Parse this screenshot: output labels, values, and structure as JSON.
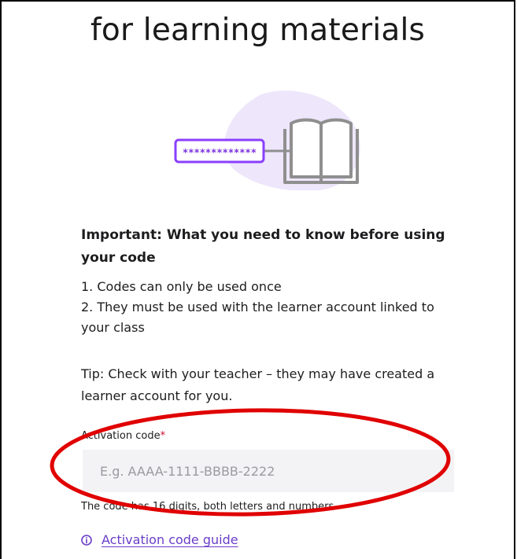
{
  "header": {
    "title": "for learning materials"
  },
  "illustration": {
    "code_mask": "*************",
    "accent_color": "#8a3ffc",
    "blob_color": "#eee6fb",
    "book_color": "#8f8f8f"
  },
  "info": {
    "heading": "Important: What you need to know before using your code",
    "rules": [
      "1. Codes can only be used once",
      "2. They must be used with the learner account linked to your class"
    ],
    "tip": "Tip: Check with your teacher – they may have created a learner account for you."
  },
  "form": {
    "label": "Activation code",
    "required_mark": "*",
    "placeholder": "E.g. AAAA-1111-BBBB-2222",
    "value": "",
    "hint": "The code has 16 digits, both letters and numbers"
  },
  "guide": {
    "icon": "info-icon",
    "link_text": "Activation code guide",
    "link_color": "#6a3ec7"
  },
  "annotation": {
    "color": "#e00000"
  }
}
